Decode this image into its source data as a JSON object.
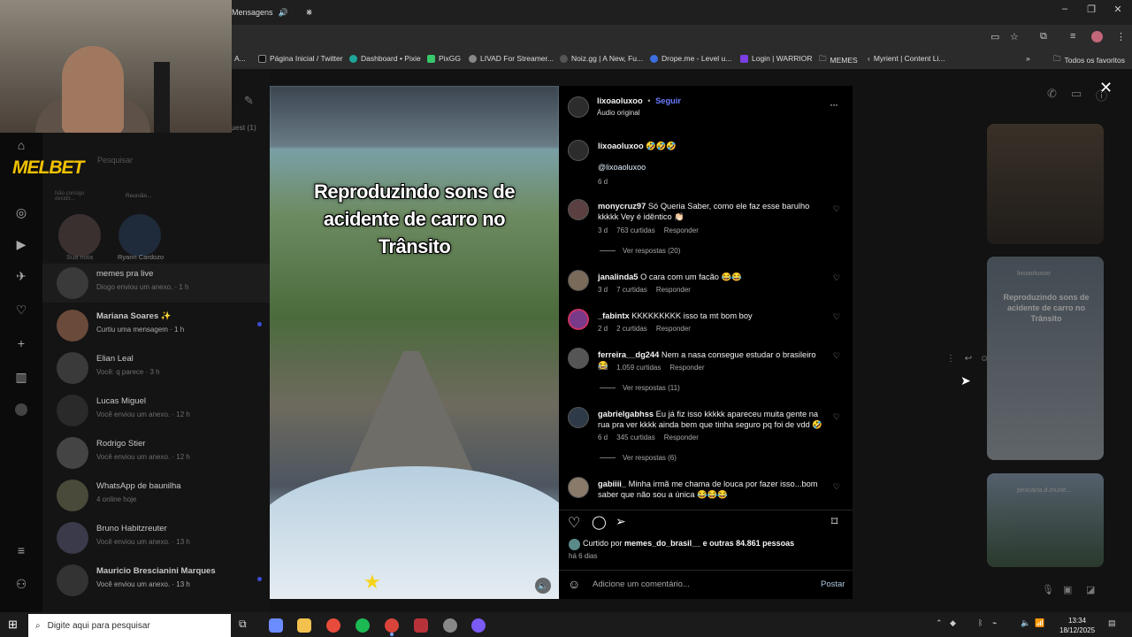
{
  "browser": {
    "tab_title": "Mensagens",
    "new_tab": "+",
    "window": {
      "min": "–",
      "restore": "❐",
      "close": "✕"
    },
    "bookmarks": [
      {
        "label": "A...",
        "color": "#444"
      },
      {
        "label": "Página Inicial / Twitter",
        "color": "#1d1d1d"
      },
      {
        "label": "Dashboard • Pixie",
        "color": "#1ea59a"
      },
      {
        "label": "PixGG",
        "color": "#38c76a"
      },
      {
        "label": "LIVAD For Streamer...",
        "color": "#888"
      },
      {
        "label": "Noiz.gg | A New, Fu...",
        "color": "#555"
      },
      {
        "label": "Drope.me - Level u...",
        "color": "#3d6fe0"
      },
      {
        "label": "Login | WARRIOR",
        "color": "#7b3fe4"
      },
      {
        "label": "MEMES",
        "color": "#777"
      },
      {
        "label": "Myrient | Content Li...",
        "color": "#666"
      }
    ],
    "bookmarks_more": "»",
    "all_bookmarks": "Todos os favoritos"
  },
  "overlay": {
    "brand_a": "MEL",
    "brand_b": "BET"
  },
  "inbox": {
    "search_placeholder": "Pesquisar",
    "requests": "uest (1)",
    "notes": [
      {
        "label": "Sua nota"
      },
      {
        "label": "Ryann Cardozo"
      }
    ],
    "note_text_1": "Não consigo decidir...",
    "note_text_2": "Reunião...",
    "conversations": [
      {
        "name": "memes pra live",
        "sub": "Diogo enviou um anexo. · 1 h"
      },
      {
        "name": "Mariana Soares ✨",
        "sub": "Curtiu uma mensagem · 1 h"
      },
      {
        "name": "Elian Leal",
        "sub": "Você: q parece · 3 h"
      },
      {
        "name": "Lucas Miguel",
        "sub": "Você enviou um anexo. · 12 h"
      },
      {
        "name": "Rodrigo Stier",
        "sub": "Você enviou um anexo. · 12 h"
      },
      {
        "name": "WhatsApp de baunilha",
        "sub": "4 online hoje"
      },
      {
        "name": "Bruno Habitzreuter",
        "sub": "Você enviou um anexo. · 13 h"
      },
      {
        "name": "Mauricio Brescianini Marques",
        "sub": "Você enviou um anexo. · 13 h"
      }
    ]
  },
  "post": {
    "video_caption": "Reproduzindo sons de acidente de carro no Trânsito",
    "author": "lixoaoluxoo",
    "dot": "•",
    "follow": "Seguir",
    "audio": "Áudio original",
    "more": "···",
    "caption_user": "lixoaoluxoo",
    "caption_text": "🤣🤣🤣",
    "mention": "@lixoaoluxoo",
    "caption_time": "6 d",
    "comments": [
      {
        "user": "monycruz97",
        "text": "Só Queria Saber, como ele faz esse barulho kkkkk Vey é idêntico 👏🏻",
        "time": "3 d",
        "likes": "763 curtidas",
        "reply": "Responder",
        "replies": "Ver respostas (20)"
      },
      {
        "user": "janalinda5",
        "text": "O cara com um facão 😂😂",
        "time": "3 d",
        "likes": "7 curtidas",
        "reply": "Responder",
        "replies": ""
      },
      {
        "user": "_fabintx",
        "text": "KKKKKKKKK isso ta mt bom boy",
        "time": "2 d",
        "likes": "2 curtidas",
        "reply": "Responder",
        "replies": ""
      },
      {
        "user": "ferreira__dg244",
        "text": "Nem a nasa consegue estudar o brasileiro 😂",
        "time": "6 d",
        "likes": "1.059 curtidas",
        "reply": "Responder",
        "replies": "Ver respostas (11)"
      },
      {
        "user": "gabrielgabhss",
        "text": "Eu já fiz isso kkkkk apareceu muita gente na rua pra ver kkkk ainda bem que tinha seguro pq foi de vdd 🤣",
        "time": "6 d",
        "likes": "345 curtidas",
        "reply": "Responder",
        "replies": "Ver respostas (6)"
      },
      {
        "user": "gabiiii_",
        "text": "Minha irmã me chama de louca por fazer isso...bom saber que não sou a única 😂😂😂",
        "time": "",
        "likes": "",
        "reply": "",
        "replies": ""
      }
    ],
    "liked_prefix": "Curtido por",
    "liked_user": "memes_do_brasil__",
    "liked_suffix": "e outras 84.861 pessoas",
    "posted": "há 6 dias",
    "comment_placeholder": "Adicione um comentário...",
    "post_button": "Postar"
  },
  "side_reels": {
    "reel2_user": "lixoaoluxoo",
    "reel2_caption": "Reproduzindo sons de acidente de carro no Trânsito",
    "reel3_user": "pescaria.d.mune..."
  },
  "taskbar": {
    "search_placeholder": "Digite aqui para pesquisar",
    "time": "13:34",
    "date": "18/12/2025",
    "apps": [
      {
        "name": "copilot",
        "color": "#6b8cff"
      },
      {
        "name": "explorer",
        "color": "#f2c14e"
      },
      {
        "name": "chrome",
        "color": "#e64b3c"
      },
      {
        "name": "spotify",
        "color": "#1db954"
      },
      {
        "name": "chrome-active",
        "color": "#d9443a"
      },
      {
        "name": "app6",
        "color": "#b8323a"
      },
      {
        "name": "app7",
        "color": "#888"
      },
      {
        "name": "discord",
        "color": "#7a5af5"
      }
    ]
  },
  "colors": {
    "accent": "#0095f6",
    "link": "#e0f1ff",
    "follow": "#6c7cff"
  }
}
